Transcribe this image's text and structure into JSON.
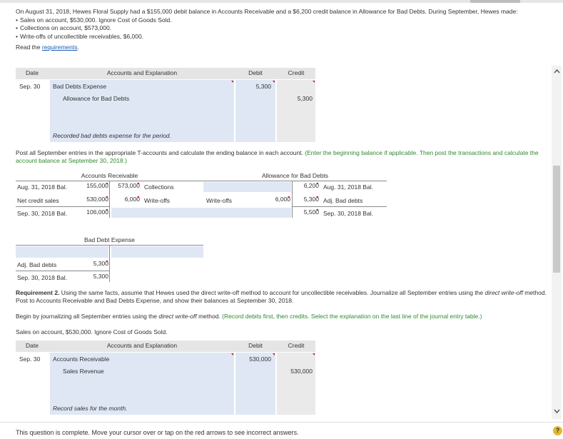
{
  "intro": {
    "text": "On August 31, 2018, Hewes Floral Supply had a $155,000 debit balance in Accounts Receivable and a $6,200 credit balance in Allowance for Bad Debts. During September, Hewes made:",
    "bullets": [
      "Sales on account, $530,000. Ignore Cost of Goods Sold.",
      "Collections on account, $573,000.",
      "Write-offs of uncollectible receivables, $6,000."
    ],
    "read_prefix": "Read the ",
    "read_link": "requirements",
    "read_suffix": "."
  },
  "journal1": {
    "headers": {
      "date": "Date",
      "explanation": "Accounts and Explanation",
      "debit": "Debit",
      "credit": "Credit"
    },
    "date": "Sep. 30",
    "line1_account": "Bad Debts Expense",
    "line1_debit": "5,300",
    "line2_account": "Allowance for Bad Debts",
    "line2_credit": "5,300",
    "explanation": "Recorded bad debts expense for the period."
  },
  "post_instruction": {
    "text": "Post all September entries in the appropriate T-accounts and calculate the ending balance in each account. ",
    "green": "(Enter the beginning balance if applicable. Then post the transactions and calculate the account balance at September 30, 2018.)"
  },
  "t_ar": {
    "title": "Accounts Receivable",
    "r1": {
      "label": "Aug. 31, 2018 Bal.",
      "debit": "155,000",
      "credit": "573,000",
      "right_label": "Collections"
    },
    "r2": {
      "label": "Net credit sales",
      "debit": "530,000",
      "credit": "6,000",
      "right_label": "Write-offs"
    },
    "r3": {
      "label": "Sep. 30, 2018 Bal.",
      "debit": "106,000"
    }
  },
  "t_allow": {
    "title": "Allowance for Bad Debts",
    "r1": {
      "credit": "6,200",
      "right_label": "Aug. 31, 2018 Bal."
    },
    "r2": {
      "left_label": "Write-offs",
      "debit": "6,000",
      "credit": "5,300",
      "right_label": "Adj. Bad debts"
    },
    "r3": {
      "credit": "5,500",
      "right_label": "Sep. 30, 2018 Bal."
    }
  },
  "t_bde": {
    "title": "Bad Debt Expense",
    "r1": {
      "label": "Adj. Bad debts",
      "debit": "5,300"
    },
    "r2": {
      "label": "Sep. 30, 2018 Bal.",
      "debit": "5,300"
    }
  },
  "req2": {
    "bold": "Requirement 2.",
    "text1": " Using the same facts, assume that Hewes used the direct write-off method to account for uncollectible receivables. Journalize all September entries using the ",
    "italic": "direct write-off",
    "text2": " method. Post to Accounts Receivable and Bad Debts Expense, and show their balances at September 30, 2018."
  },
  "begin": {
    "text1": "Begin by journalizing all September entries using the ",
    "italic": "direct write-off",
    "text2": " method. ",
    "green": "(Record debits first, then credits. Select the explanation on the last line of the journal entry table.)"
  },
  "sales_line": "Sales on account, $530,000. Ignore Cost of Goods Sold.",
  "journal2": {
    "headers": {
      "date": "Date",
      "explanation": "Accounts and Explanation",
      "debit": "Debit",
      "credit": "Credit"
    },
    "date": "Sep. 30",
    "line1_account": "Accounts Receivable",
    "line1_debit": "530,000",
    "line2_account": "Sales Revenue",
    "line2_credit": "530,000",
    "explanation": "Record sales for the month."
  },
  "footer": "This question is complete. Move your cursor over or tap on the red arrows to see incorrect answers.",
  "icons": {
    "scroll_up": "chevron-up-icon",
    "scroll_down": "chevron-down-icon",
    "help": "help-icon"
  },
  "help_glyph": "?",
  "colors": {
    "input_blue": "#dfe7f5",
    "header_grey": "#e5e5e5",
    "instruction_green": "#2e8a2e",
    "error_red": "#c0151b",
    "link_blue": "#1a5eb8"
  }
}
